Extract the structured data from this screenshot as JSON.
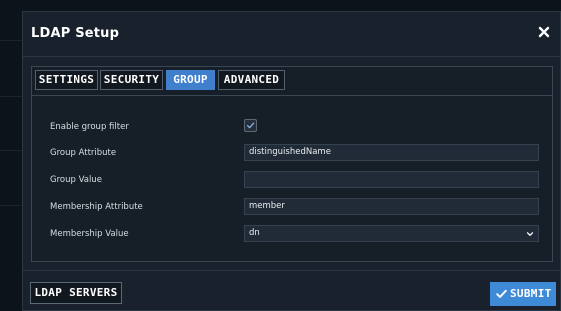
{
  "modal": {
    "title": "LDAP Setup",
    "close_icon": "close-icon"
  },
  "tabs": [
    {
      "label": "SETTINGS",
      "active": false
    },
    {
      "label": "SECURITY",
      "active": false
    },
    {
      "label": "GROUP",
      "active": true
    },
    {
      "label": "ADVANCED",
      "active": false
    }
  ],
  "form": {
    "enable_group_filter": {
      "label": "Enable group filter",
      "checked": true
    },
    "group_attribute": {
      "label": "Group Attribute",
      "value": "distinguishedName"
    },
    "group_value": {
      "label": "Group Value",
      "value": ""
    },
    "membership_attribute": {
      "label": "Membership Attribute",
      "value": "member"
    },
    "membership_value": {
      "label": "Membership Value",
      "value": "dn"
    }
  },
  "footer": {
    "ldap_servers_label": "LDAP SERVERS",
    "submit_label": "SUBMIT"
  },
  "colors": {
    "accent": "#3f8ad6",
    "active_tab": "#3f7fcc",
    "modal_bg": "#18212c"
  }
}
